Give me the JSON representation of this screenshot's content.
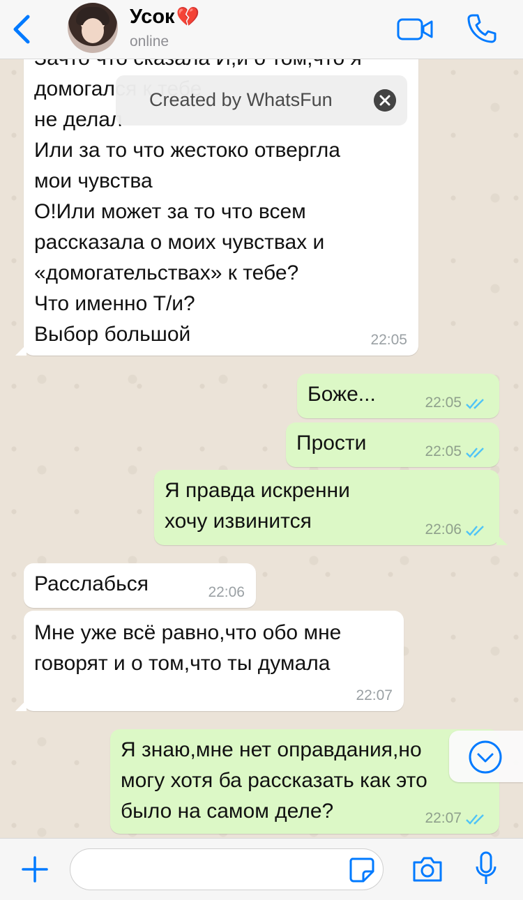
{
  "header": {
    "contact_name": "Усок",
    "heart": "💔",
    "status": "online"
  },
  "toast": {
    "text": "Created by WhatsFun"
  },
  "messages": [
    {
      "direction": "incoming",
      "text": "Зачто что сказала И,и о том,что я\nдомогался к тебе\nне делал\nИли за то что жестоко отвергла\nмои чувства\nО!Или может за то что всем\nрассказала о моих чувствах и\n«домогательствах» к тебе?\nЧто именно Т/и?\nВыбор большой",
      "time": "22:05"
    },
    {
      "direction": "outgoing",
      "text": "Боже...",
      "time": "22:05",
      "status": "read"
    },
    {
      "direction": "outgoing",
      "text": "Прости",
      "time": "22:05",
      "status": "read"
    },
    {
      "direction": "outgoing",
      "text": "Я правда искренни\nхочу извинится",
      "time": "22:06",
      "status": "read"
    },
    {
      "direction": "incoming",
      "text": "Расслабься",
      "time": "22:06"
    },
    {
      "direction": "incoming",
      "text": "Мне уже всё равно,что обо мне\nговорят и о том,что ты думала",
      "time": "22:07"
    },
    {
      "direction": "outgoing",
      "text": "Я знаю,мне нет оправдания,но\nмогу хотя ба рассказать как это\nбыло на самом деле?",
      "time": "22:07",
      "status": "read"
    }
  ],
  "colors": {
    "accent": "#007aff",
    "outgoing_bubble": "#dcf8c6",
    "incoming_bubble": "#ffffff",
    "read_ticks": "#4fc3f7"
  },
  "icons": {
    "back": "chevron-left-icon",
    "video": "video-call-icon",
    "phone": "phone-icon",
    "attach": "plus-icon",
    "sticker": "sticker-icon",
    "camera": "camera-icon",
    "mic": "microphone-icon",
    "scroll": "chevron-down-icon"
  }
}
